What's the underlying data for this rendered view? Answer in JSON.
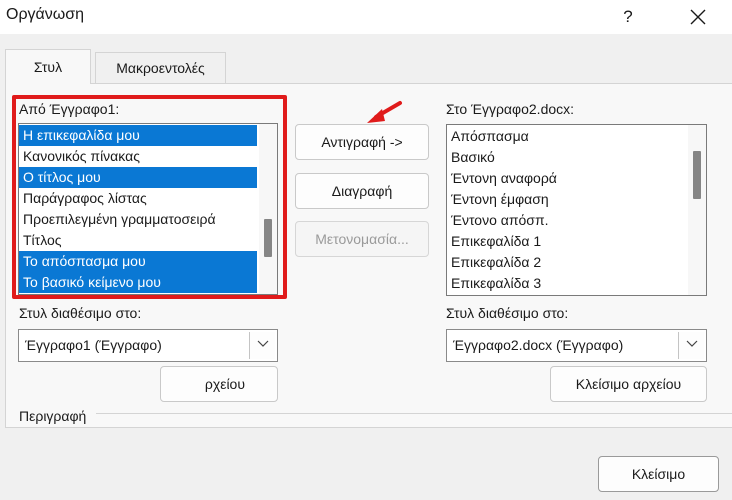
{
  "window": {
    "title": "Οργάνωση",
    "help_label": "?",
    "close_icon": "close-icon"
  },
  "tabs": [
    {
      "label": "Στυλ",
      "active": true
    },
    {
      "label": "Μακροεντολές",
      "active": false
    }
  ],
  "left": {
    "list_label": "Από Έγγραφο1:",
    "items": [
      {
        "label": "Η επικεφαλίδα μου",
        "selected": true
      },
      {
        "label": "Κανονικός πίνακας",
        "selected": false
      },
      {
        "label": "Ο τίτλος μου",
        "selected": true
      },
      {
        "label": "Παράγραφος λίστας",
        "selected": false
      },
      {
        "label": "Προεπιλεγμένη γραμματοσειρά",
        "selected": false
      },
      {
        "label": "Τίτλος",
        "selected": false
      },
      {
        "label": "Το απόσπασμα μου",
        "selected": true
      },
      {
        "label": "Το βασικό κείμενο μου",
        "selected": true
      }
    ],
    "available_label": "Στυλ διαθέσιμο στο:",
    "available_value": "Έγγραφο1 (Έγγραφο)",
    "file_button": "ρχείου"
  },
  "middle": {
    "copy_button": "Αντιγραφή ->",
    "delete_button": "Διαγραφή",
    "rename_button": "Μετονομασία..."
  },
  "right": {
    "list_label": "Στο Έγγραφο2.docx:",
    "items": [
      {
        "label": "Απόσπασμα"
      },
      {
        "label": "Βασικό"
      },
      {
        "label": "Έντονη αναφορά"
      },
      {
        "label": "Έντονη έμφαση"
      },
      {
        "label": "Έντονο απόσπ."
      },
      {
        "label": "Επικεφαλίδα 1"
      },
      {
        "label": "Επικεφαλίδα 2"
      },
      {
        "label": "Επικεφαλίδα 3"
      }
    ],
    "available_label": "Στυλ διαθέσιμο στο:",
    "available_value": "Έγγραφο2.docx (Έγγραφο)",
    "file_button": "Κλείσιμο αρχείου"
  },
  "description_label": "Περιγραφή",
  "footer": {
    "close_button": "Κλείσιμο"
  },
  "colors": {
    "selection": "#0a78d4",
    "highlight_frame": "#e01b1b",
    "annotation_arrow": "#e01b1b"
  }
}
